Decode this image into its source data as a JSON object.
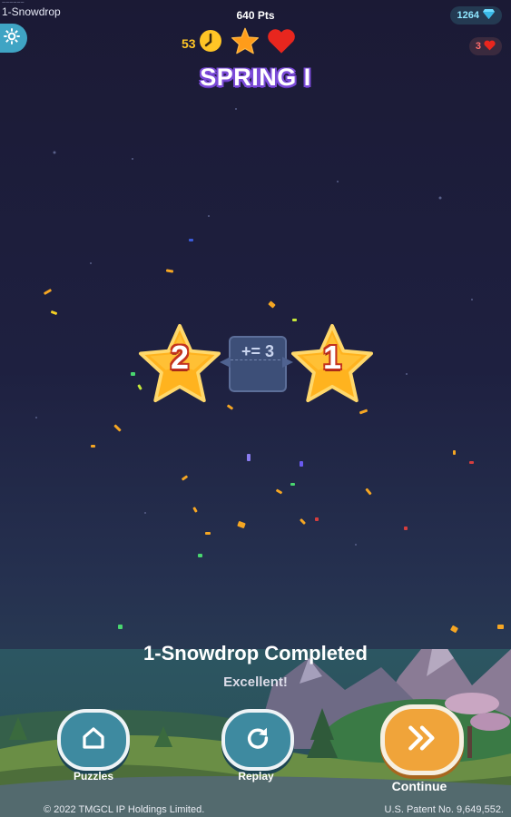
{
  "header": {
    "small_label": "~~~~~~",
    "level_name": "1-Snowdrop",
    "points": "640 Pts",
    "gems": "1264",
    "lives": "3",
    "timer": "53"
  },
  "title": "SPRING I",
  "result": {
    "star_left": "2",
    "bonus": "+= 3",
    "star_right": "1"
  },
  "completion": {
    "message": "1-Snowdrop Completed",
    "rating": "Excellent!"
  },
  "buttons": {
    "puzzles": "Puzzles",
    "replay": "Replay",
    "continue": "Continue"
  },
  "footer": {
    "copyright": "© 2022 TMGCL IP Holdings Limited.",
    "patent": "U.S. Patent No. 9,649,552."
  },
  "colors": {
    "accent_gold": "#ffc526",
    "heart_red": "#e8261e",
    "button_teal": "#3e8aa0",
    "continue_orange": "#f0a43a",
    "title_purple": "#7b4ad8"
  },
  "icons": {
    "settings": "gear-icon",
    "timer": "clock-icon",
    "star": "star-icon",
    "heart": "heart-icon",
    "gem": "diamond-icon",
    "home": "home-icon",
    "replay": "replay-icon",
    "continue": "double-chevron-icon"
  }
}
